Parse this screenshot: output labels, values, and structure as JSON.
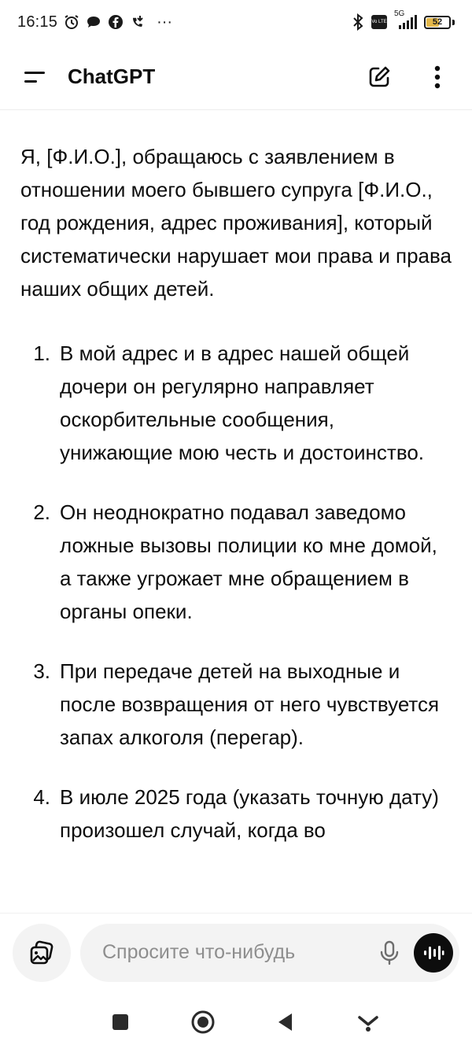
{
  "status_bar": {
    "time": "16:15",
    "more_dots": "···",
    "network_label": "5G",
    "volte_label": "Vo LTE",
    "battery_level": "52"
  },
  "header": {
    "title": "ChatGPT"
  },
  "message": {
    "intro": "Я, [Ф.И.О.], обращаюсь с заявлением в отношении моего бывшего супруга [Ф.И.О., год рождения, адрес проживания], который систематически нарушает мои права и права наших общих детей.",
    "items": [
      {
        "number": "1.",
        "text": "В мой адрес и в адрес нашей общей дочери он регулярно направляет оскорбительные сообщения, унижающие мою честь и достоинство."
      },
      {
        "number": "2.",
        "text": "Он неоднократно подавал заведомо ложные вызовы полиции ко мне домой, а также угрожает мне обращением в органы опеки."
      },
      {
        "number": "3.",
        "text": "При передаче детей на выходные и после возвращения от него чувствуется запах алкоголя (перегар)."
      },
      {
        "number": "4.",
        "text": "В июле 2025 года (указать точную дату) произошел случай, когда во"
      }
    ]
  },
  "composer": {
    "placeholder": "Спросите что-нибудь"
  },
  "colors": {
    "text": "#0d0d0d",
    "placeholder": "#8e8e8e",
    "pill_background": "#f3f3f3",
    "battery_fill": "#e5b84a"
  }
}
